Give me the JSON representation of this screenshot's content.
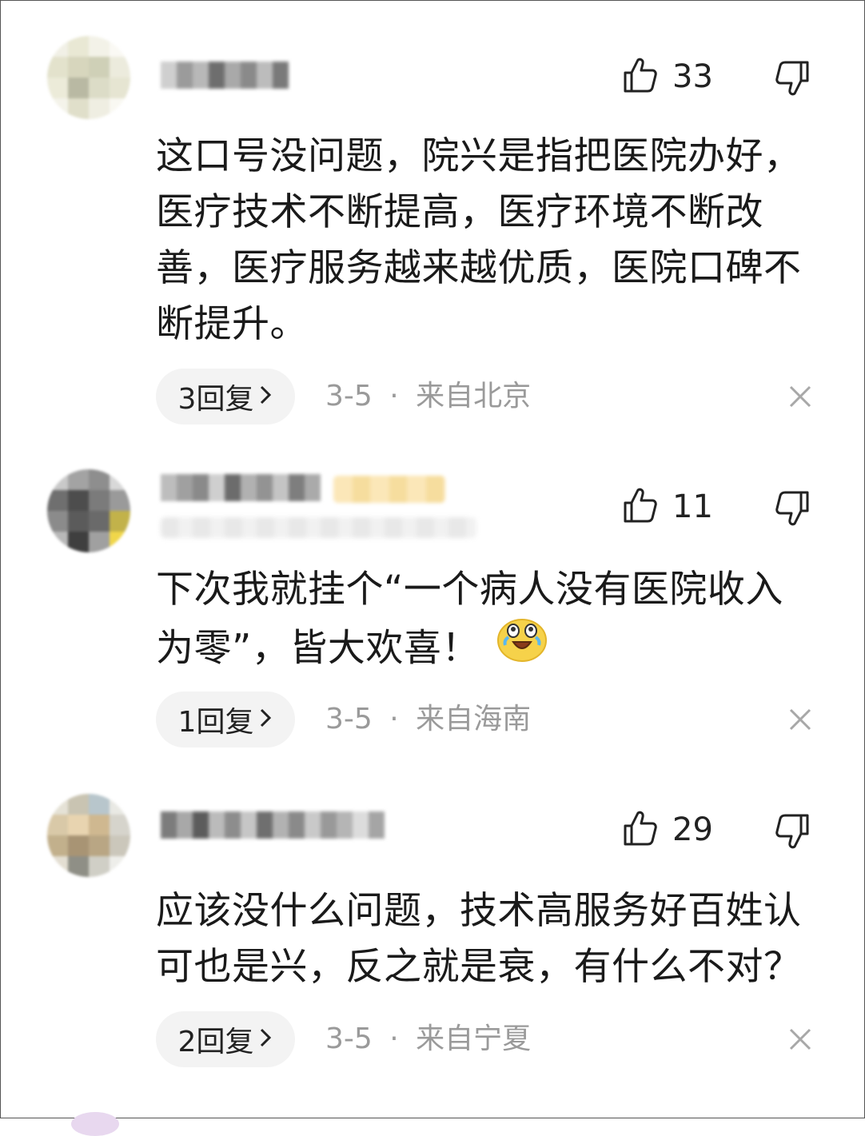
{
  "comments": [
    {
      "likes": "33",
      "text": "这口号没问题，院兴是指把医院办好，医疗技术不断提高，医疗环境不断改善，医疗服务越来越优质，医院口碑不断提升。",
      "reply_label": "3回复",
      "date": "3-5",
      "separator": "·",
      "location": "来自北京"
    },
    {
      "likes": "11",
      "text": "下次我就挂个“一个病人没有医院收入为零”，皆大欢喜！",
      "reply_label": "1回复",
      "date": "3-5",
      "separator": "·",
      "location": "来自海南"
    },
    {
      "likes": "29",
      "text": "应该没什么问题，技术高服务好百姓认可也是兴，反之就是衰，有什么不对？",
      "reply_label": "2回复",
      "date": "3-5",
      "separator": "·",
      "location": "来自宁夏"
    }
  ],
  "icons": {
    "like": "thumbs-up-icon",
    "dislike": "thumbs-down-icon",
    "close": "close-icon",
    "chevron": "chevron-right-icon",
    "emoji": "laugh-cry-emoji-icon"
  },
  "colors": {
    "meta_text": "#9a9a9a",
    "pill_bg": "#f3f3f3",
    "body_text": "#1a1a1a"
  }
}
